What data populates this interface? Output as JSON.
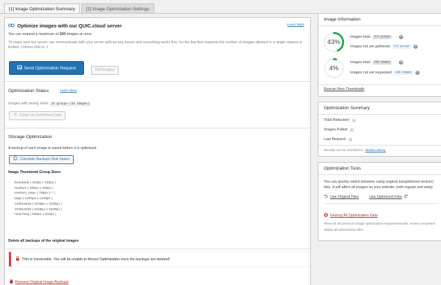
{
  "tabs": [
    {
      "label": "[1] Image Optimization Summary",
      "active": true
    },
    {
      "label": "[2] Image Optimization Settings",
      "active": false
    }
  ],
  "main": {
    "title": "Optimize images with our QUIC.cloud server",
    "learn_more": "Learn More",
    "max_images_prefix": "You can request a maximum of ",
    "max_images_value": "200",
    "max_images_suffix": " images at once.",
    "server_note": "To make sure our server can communicate with your server without any issues and everything works fine, for the few first requests the number of images allowed in a single request is limited. Current limit is: 1",
    "send_button": "Send Optimization Request",
    "pull_button": "Pull Images"
  },
  "status": {
    "title": "Optimization Status",
    "learn_more": "Learn More",
    "wrong_meta_label": "Images with wrong meta:",
    "wrong_meta_value": "32 groups (32 images)",
    "cleanup_button": "Clean Up Unfinished Data"
  },
  "storage": {
    "title": "Storage Optimization",
    "backup_note": "A backup of each image is saved before it is optimized.",
    "calc_button": "Calculate Backups Disk Space",
    "group_sizes_title": "Image Thumbnail Group Sizes",
    "sizes": [
      "thumbnail ( 150px x 150px )",
      "medium ( 300px x 300px )",
      "medium_large ( 768px x * )",
      "large ( 1200px x 1200px )",
      "1536x1536 ( 1536px x 1536px )",
      "2048x2048 ( 2048px x 2048px )",
      "neve-blog ( 930px x 620px )"
    ],
    "delete_title": "Delete all backups of the original images",
    "warning": "This is irreversible. You will be unable to Revert Optimization once the backups are deleted!",
    "remove_link": "Remove Original Image Backups"
  },
  "info": {
    "title": "Image Information",
    "total_label_1": "Images total:",
    "total_value_1": "471 groups",
    "not_gathered_label": "Images not yet gathered:",
    "not_gathered_value": "171 groups",
    "percent_1": "43%",
    "percent_1_value": 43,
    "total_label_2": "Images total:",
    "total_value_2": "990 images",
    "not_requested_label": "Images not yet requested:",
    "not_requested_value": "966 images",
    "percent_2": "4%",
    "percent_2_value": 4,
    "rescan_link": "Rescan New Thumbnails"
  },
  "summary": {
    "title": "Optimization Summary",
    "total_reduction": "Total Reduction:",
    "images_pulled": "Images Pulled:",
    "last_request": "Last Request:",
    "badge": "-",
    "results_prefix": "Results can be checked in ",
    "media_library": "Media Library",
    "results_suffix": "."
  },
  "tools": {
    "title": "Optimization Tools",
    "desc_1": "You can quickly switch between using original (unoptimized version)",
    "desc_2": "files. It will affect all images on your website, both regular and webp",
    "use_original": "Use Original Files",
    "use_optimized": "Use Optimized Files",
    "destroy_link": "Destroy All Optimization Data",
    "destroy_desc_1": "Remove all previous image optimization requests/results, revert completed",
    "destroy_desc_2": "delete all optimization files."
  }
}
